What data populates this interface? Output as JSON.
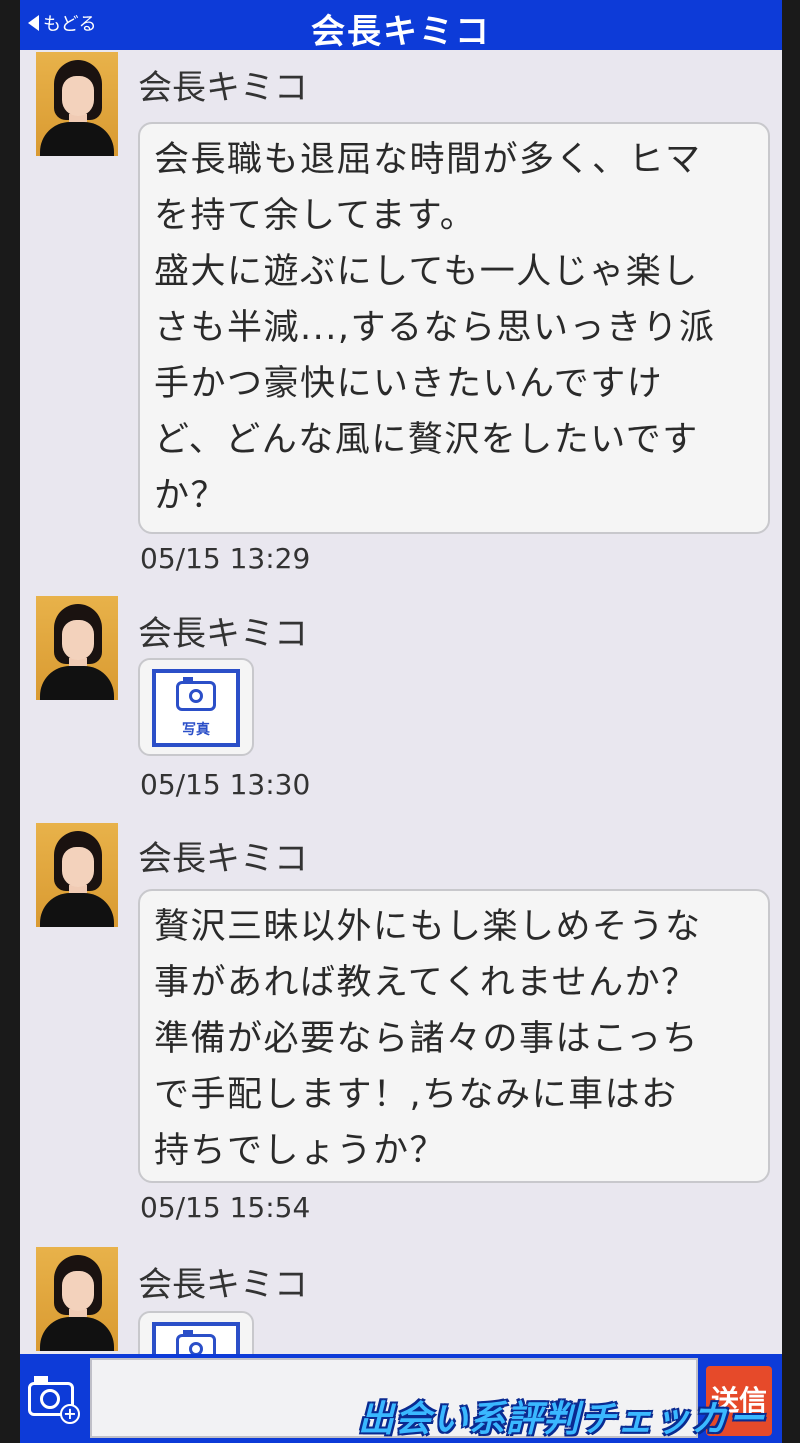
{
  "header": {
    "back_label": "もどる",
    "title": "会長キミコ"
  },
  "messages": [
    {
      "sender": "会長キミコ",
      "type": "text",
      "lines": [
        "会長職も退屈な時間が多く、ヒマ",
        "を持て余してます。",
        "盛大に遊ぶにしても一人じゃ楽し",
        "さも半減...,するなら思いっきり派",
        "手かつ豪快にいきたいんですけ",
        "ど、どんな風に贅沢をしたいです",
        "か？"
      ],
      "time": "05/15 13:29"
    },
    {
      "sender": "会長キミコ",
      "type": "photo",
      "photo_label": "写真",
      "time": "05/15 13:30"
    },
    {
      "sender": "会長キミコ",
      "type": "text",
      "lines": [
        "贅沢三昧以外にもし楽しめそうな",
        "事があれば教えてくれませんか？",
        "準備が必要なら諸々の事はこっち",
        "で手配します！,ちなみに車はお",
        "持ちでしょうか？"
      ],
      "time": "05/15 15:54"
    },
    {
      "sender": "会長キミコ",
      "type": "photo",
      "photo_label": "写真"
    }
  ],
  "input_bar": {
    "send_label": "送信",
    "message_value": ""
  },
  "watermark": "出会い系評判チェッカー",
  "colors": {
    "header_blue": "#0d3bd8",
    "send_red": "#e64a2a",
    "photo_blue": "#2b4fc8"
  }
}
